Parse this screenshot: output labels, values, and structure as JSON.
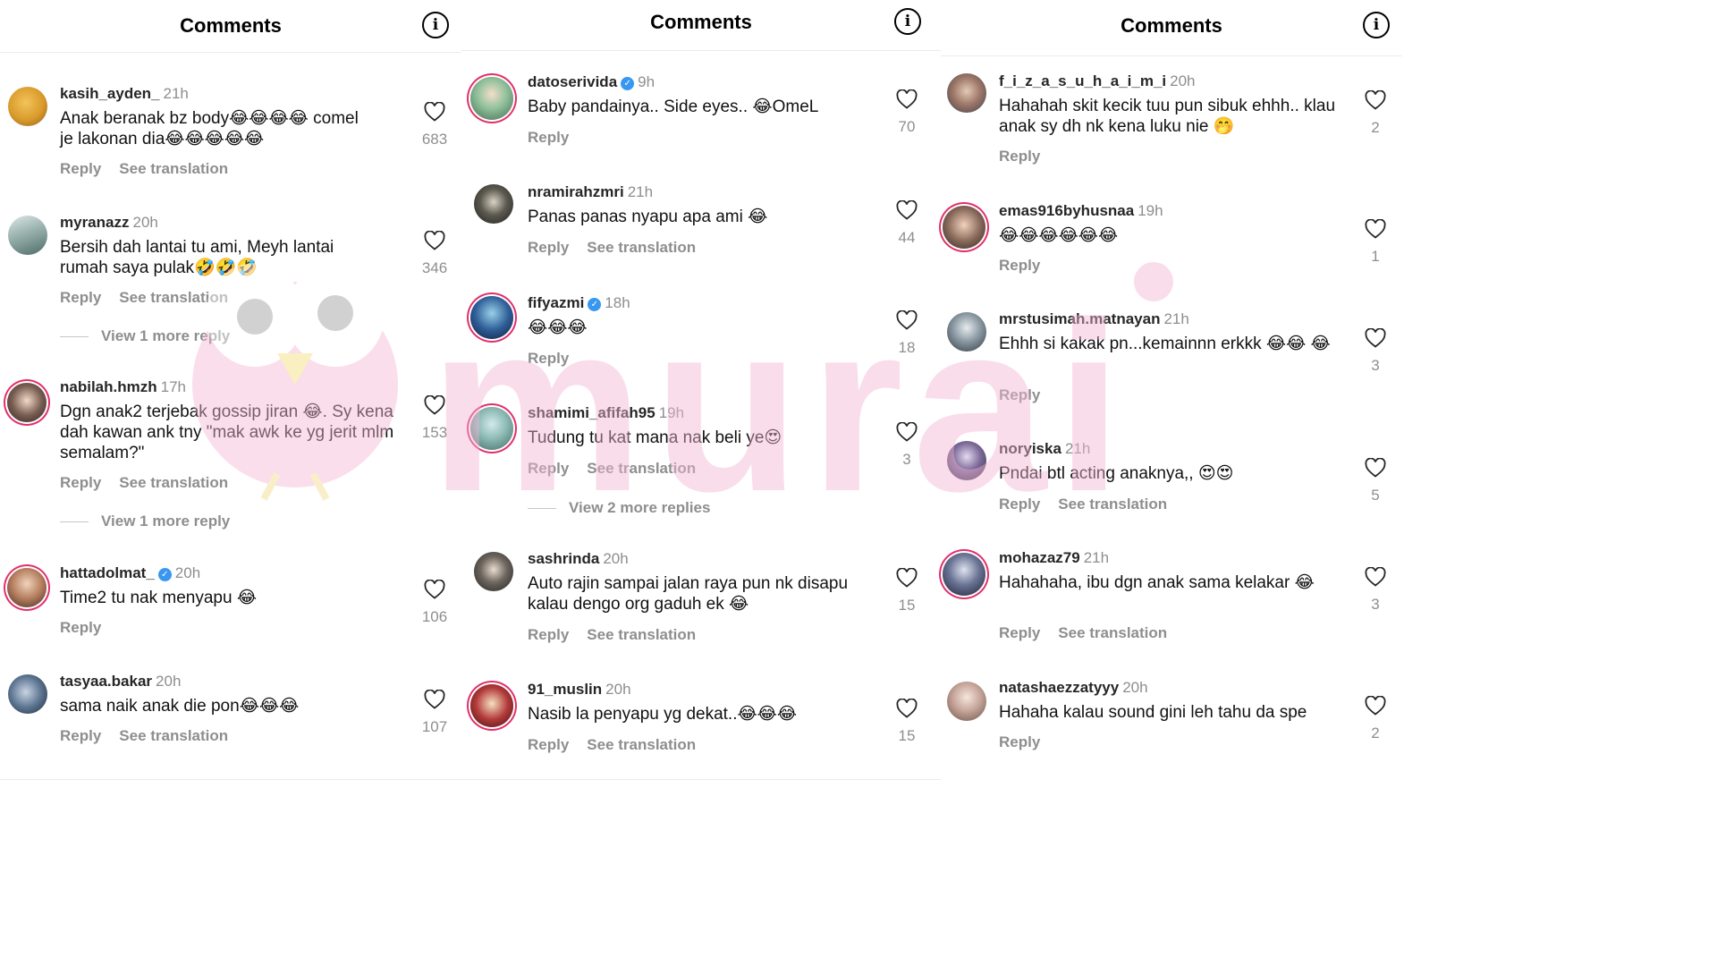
{
  "panels": [
    {
      "title": "Comments",
      "comments": [
        {
          "user": "kasih_ayden_",
          "time": "21h",
          "verified": false,
          "text": "Anak beranak bz body😂😂😂😂 comel je lakonan dia😂😂😂😂😂",
          "reply": "Reply",
          "translate": "See translation",
          "likes": "683"
        },
        {
          "user": "myranazz",
          "time": "20h",
          "verified": false,
          "text": "Bersih dah lantai tu ami, Meyh lantai rumah saya pulak🤣🤣🤣",
          "reply": "Reply",
          "translate": "See translation",
          "likes": "346",
          "more": "View 1 more reply"
        },
        {
          "user": "nabilah.hmzh",
          "time": "17h",
          "verified": false,
          "text": "Dgn anak2 terjebak gossip jiran 😂. Sy kena dah kawan ank tny \"mak awk ke yg jerit mlm semalam?\"",
          "reply": "Reply",
          "translate": "See translation",
          "likes": "153",
          "more": "View 1 more reply"
        },
        {
          "user": "hattadolmat_",
          "time": "20h",
          "verified": true,
          "text": "Time2 tu nak menyapu 😂",
          "reply": "Reply",
          "translate": "",
          "likes": "106"
        },
        {
          "user": "tasyaa.bakar",
          "time": "20h",
          "verified": false,
          "text": "sama naik anak die pon😂😂😂",
          "reply": "Reply",
          "translate": "See translation",
          "likes": "107"
        }
      ]
    },
    {
      "title": "Comments",
      "comments": [
        {
          "user": "datoserivida",
          "time": "9h",
          "verified": true,
          "text": "Baby pandainya.. Side eyes.. 😂OmeL",
          "reply": "Reply",
          "translate": "",
          "likes": "70"
        },
        {
          "user": "nramirahzmri",
          "time": "21h",
          "verified": false,
          "text": "Panas panas nyapu apa ami 😂",
          "reply": "Reply",
          "translate": "See translation",
          "likes": "44"
        },
        {
          "user": "fifyazmi",
          "time": "18h",
          "verified": true,
          "text": "😂😂😂",
          "reply": "Reply",
          "translate": "",
          "likes": "18"
        },
        {
          "user": "shamimi_afifah95",
          "time": "19h",
          "verified": false,
          "text": "Tudung tu kat mana nak beli ye😍",
          "reply": "Reply",
          "translate": "See translation",
          "likes": "3",
          "more": "View 2 more replies"
        },
        {
          "user": "sashrinda",
          "time": "20h",
          "verified": false,
          "text": "Auto rajin sampai jalan raya pun nk disapu kalau dengo org gaduh ek 😂",
          "reply": "Reply",
          "translate": "See translation",
          "likes": "15"
        },
        {
          "user": "91_muslin",
          "time": "20h",
          "verified": false,
          "text": "Nasib la penyapu yg dekat..😂😂😂",
          "reply": "Reply",
          "translate": "See translation",
          "likes": "15"
        }
      ]
    },
    {
      "title": "Comments",
      "comments": [
        {
          "user": "f_i_z_a_s_u_h_a_i_m_i",
          "time": "20h",
          "verified": false,
          "text": "Hahahah skit kecik tuu pun sibuk ehhh.. klau anak sy dh nk kena luku nie 🤭",
          "reply": "Reply",
          "translate": "",
          "likes": "2"
        },
        {
          "user": "emas916byhusnaa",
          "time": "19h",
          "verified": false,
          "text": "😂😂😂😂😂😂",
          "reply": "Reply",
          "translate": "",
          "likes": "1"
        },
        {
          "user": "mrstusimah.matnayan",
          "time": "21h",
          "verified": false,
          "text": "Ehhh si kakak pn...kemainnn erkkk 😂😂 😂",
          "reply": "Reply",
          "translate": "",
          "likes": "3"
        },
        {
          "user": "noryiska",
          "time": "21h",
          "verified": false,
          "text": "Pndai btl acting anaknya,, 😍😍",
          "reply": "Reply",
          "translate": "See translation",
          "likes": "5"
        },
        {
          "user": "mohazaz79",
          "time": "21h",
          "verified": false,
          "text": "Hahahaha, ibu dgn anak sama kelakar 😂",
          "reply": "Reply",
          "translate": "See translation",
          "likes": "3"
        },
        {
          "user": "natashaezzatyyy",
          "time": "20h",
          "verified": false,
          "text": "Hahaha kalau sound gini leh tahu da spe",
          "reply": "Reply",
          "translate": "",
          "likes": "2"
        }
      ]
    }
  ],
  "watermark": "murai",
  "colors": {
    "accent": "#e1306c",
    "verified": "#3897f0",
    "muted": "#8e8e8e",
    "watermark": "#f2b6d4"
  }
}
